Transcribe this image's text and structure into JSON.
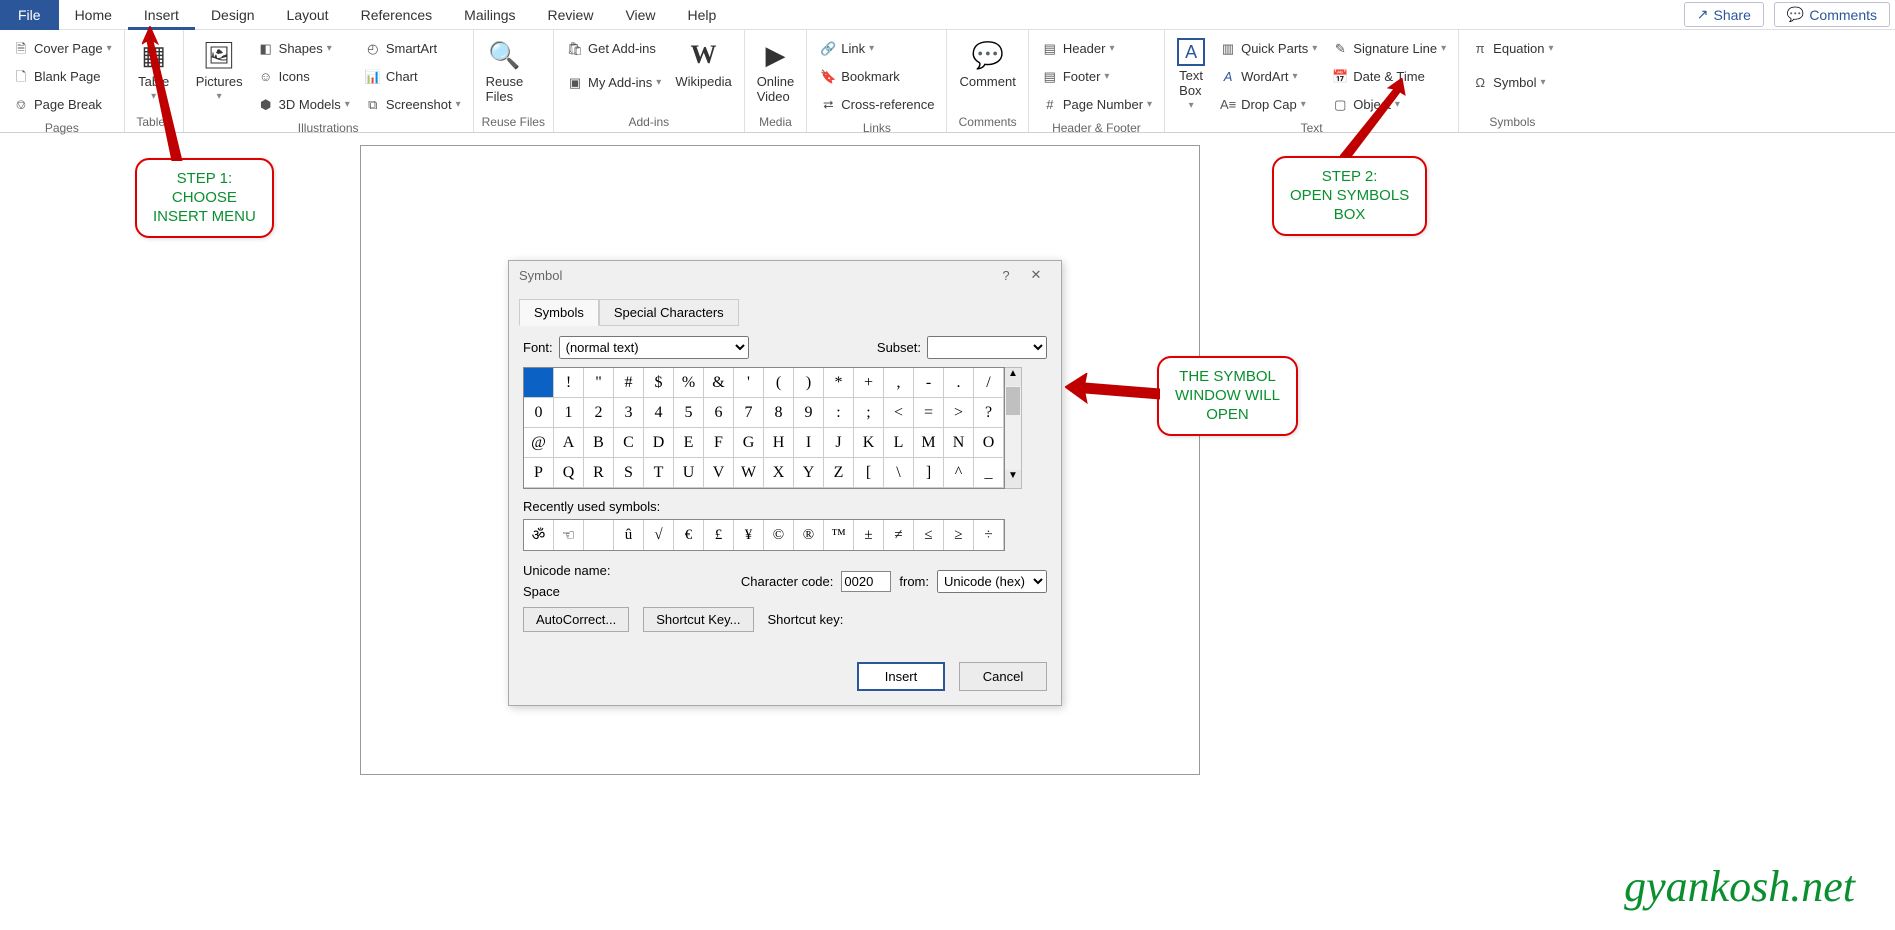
{
  "tabs": {
    "file": "File",
    "home": "Home",
    "insert": "Insert",
    "design": "Design",
    "layout": "Layout",
    "references": "References",
    "mailings": "Mailings",
    "review": "Review",
    "view": "View",
    "help": "Help",
    "share": "Share",
    "comments": "Comments"
  },
  "ribbon": {
    "pages": {
      "label": "Pages",
      "cover": "Cover Page",
      "blank": "Blank Page",
      "break": "Page Break"
    },
    "tables": {
      "label": "Tables",
      "table": "Table"
    },
    "illustrations": {
      "label": "Illustrations",
      "pictures": "Pictures",
      "shapes": "Shapes",
      "icons": "Icons",
      "models": "3D Models",
      "smartart": "SmartArt",
      "chart": "Chart",
      "screenshot": "Screenshot"
    },
    "reuse": {
      "label": "Reuse Files",
      "btn": "Reuse\nFiles"
    },
    "addins": {
      "label": "Add-ins",
      "get": "Get Add-ins",
      "my": "My Add-ins",
      "wiki": "Wikipedia"
    },
    "media": {
      "label": "Media",
      "video": "Online\nVideo"
    },
    "links": {
      "label": "Links",
      "link": "Link",
      "bookmark": "Bookmark",
      "crossref": "Cross-reference"
    },
    "comments": {
      "label": "Comments",
      "btn": "Comment"
    },
    "hf": {
      "label": "Header & Footer",
      "header": "Header",
      "footer": "Footer",
      "page": "Page Number"
    },
    "text": {
      "label": "Text",
      "textbox": "Text\nBox",
      "quick": "Quick Parts",
      "wordart": "WordArt",
      "dropcap": "Drop Cap",
      "sig": "Signature Line",
      "date": "Date & Time",
      "object": "Object"
    },
    "symbols": {
      "label": "Symbols",
      "equation": "Equation",
      "symbol": "Symbol"
    }
  },
  "dialog": {
    "title": "Symbol",
    "tab1": "Symbols",
    "tab2": "Special Characters",
    "font_label": "Font:",
    "font_value": "(normal text)",
    "subset_label": "Subset:",
    "grid": [
      [
        " ",
        "!",
        "\"",
        "#",
        "$",
        "%",
        "&",
        "'",
        "(",
        ")",
        "*",
        "+",
        ",",
        "-",
        ".",
        "/"
      ],
      [
        "0",
        "1",
        "2",
        "3",
        "4",
        "5",
        "6",
        "7",
        "8",
        "9",
        ":",
        ";",
        "<",
        "=",
        ">",
        "?"
      ],
      [
        "@",
        "A",
        "B",
        "C",
        "D",
        "E",
        "F",
        "G",
        "H",
        "I",
        "J",
        "K",
        "L",
        "M",
        "N",
        "O"
      ],
      [
        "P",
        "Q",
        "R",
        "S",
        "T",
        "U",
        "V",
        "W",
        "X",
        "Y",
        "Z",
        "[",
        "\\",
        "]",
        "^",
        "_"
      ]
    ],
    "recent_label": "Recently used symbols:",
    "recent": [
      "ॐ",
      "☜",
      " ",
      "û",
      "√",
      "€",
      "£",
      "¥",
      "©",
      "®",
      "™",
      "±",
      "≠",
      "≤",
      "≥",
      "÷"
    ],
    "unicode_label": "Unicode name:",
    "space": "Space",
    "charcode_label": "Character code:",
    "charcode": "0020",
    "from_label": "from:",
    "from_value": "Unicode (hex)",
    "autocorrect": "AutoCorrect...",
    "shortcutkey": "Shortcut Key...",
    "shortcut_label": "Shortcut key:",
    "insert": "Insert",
    "cancel": "Cancel"
  },
  "callouts": {
    "step1": "STEP 1:\nCHOOSE\nINSERT MENU",
    "step2": "STEP 2:\nOPEN SYMBOLS\nBOX",
    "win": "THE SYMBOL\nWINDOW WILL\nOPEN"
  },
  "watermark": "gyankosh.net"
}
